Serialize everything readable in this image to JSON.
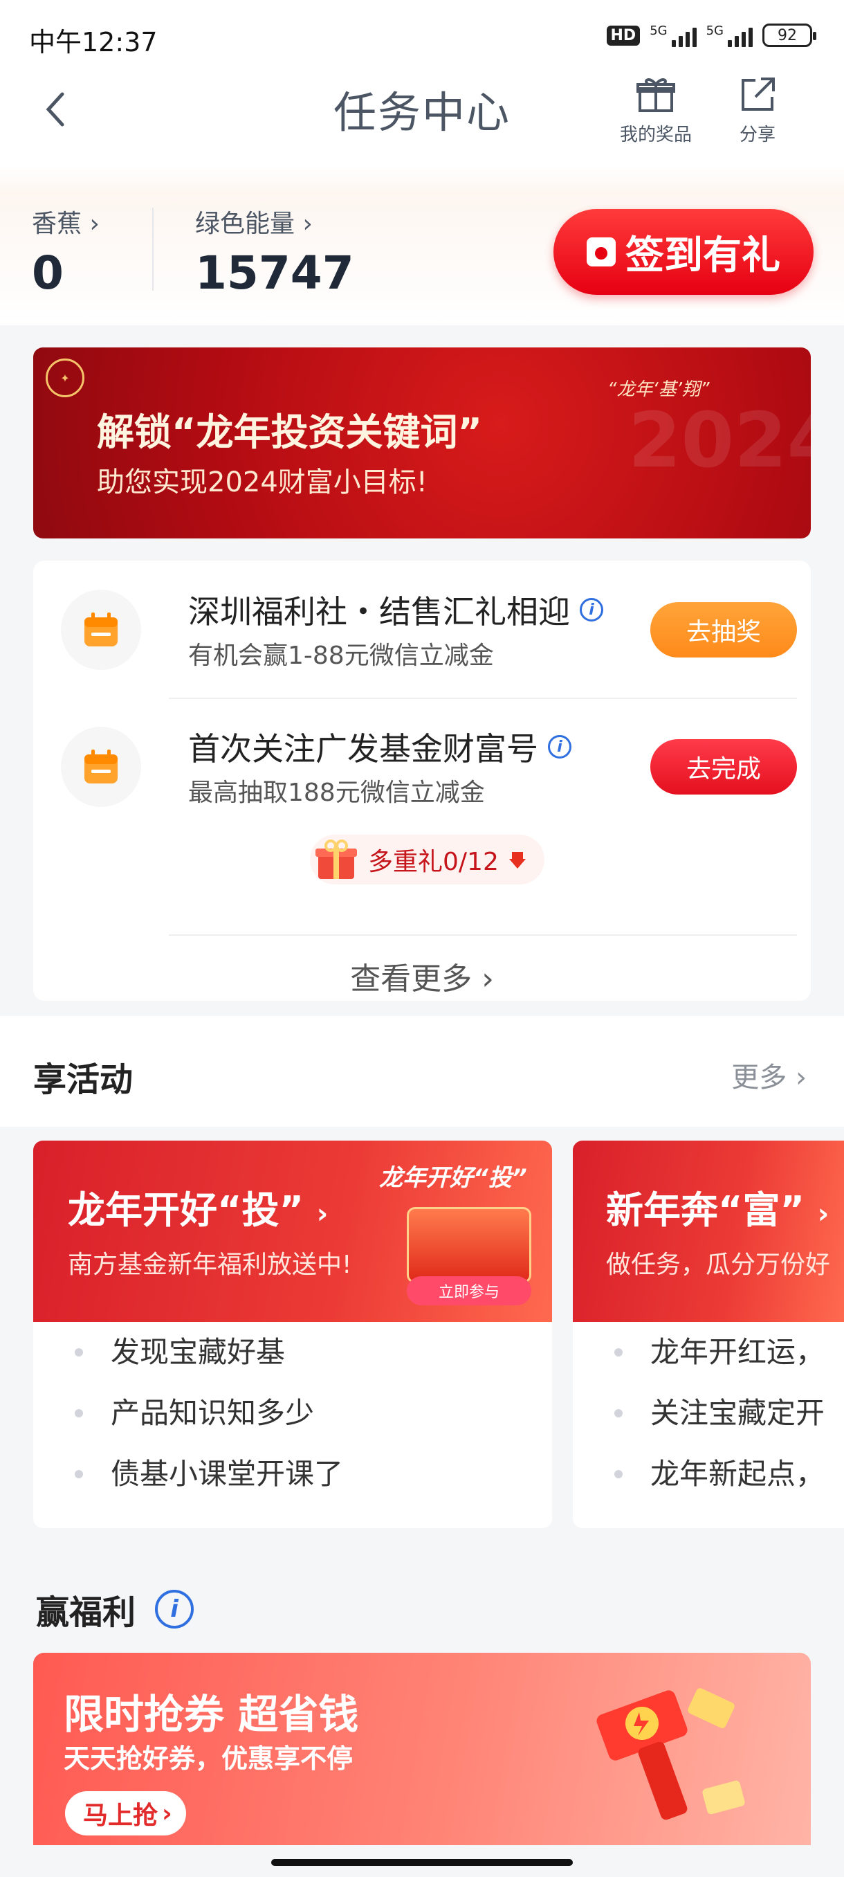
{
  "status_bar": {
    "time": "中午12:37",
    "hd": "HD",
    "net1": "5G",
    "net2": "5G",
    "battery": "92"
  },
  "header": {
    "title": "任务中心",
    "prizes_label": "我的奖品",
    "share_label": "分享"
  },
  "balance": {
    "banana_label": "香蕉",
    "banana_value": "0",
    "energy_label": "绿色能量",
    "energy_value": "15747",
    "checkin_label": "签到有礼"
  },
  "banner": {
    "title": "解锁“龙年投资关键词”",
    "subtitle": "助您实现2024财富小目标!",
    "tag": "“龙年‘基’翔”"
  },
  "tasks": [
    {
      "title": "深圳福利社・结售汇礼相迎",
      "subtitle": "有机会赢1-88元微信立减金",
      "button": "去抽奖"
    },
    {
      "title": "首次关注广发基金财富号",
      "subtitle": "最高抽取188元微信立减金",
      "button": "去完成"
    }
  ],
  "multi_gift": "多重礼0/12",
  "see_more": "查看更多",
  "activities": {
    "title": "享活动",
    "more": "更多",
    "cards": [
      {
        "title": "龙年开好“投”",
        "subtitle": "南方基金新年福利放送中!",
        "art_tag": "龙年开好“投”",
        "join": "立即参与",
        "items": [
          "发现宝藏好基",
          "产品知识知多少",
          "债基小课堂开课了"
        ]
      },
      {
        "title": "新年奔“富”",
        "subtitle": "做任务，瓜分万份好",
        "items": [
          "龙年开红运，",
          "关注宝藏定开",
          "龙年新起点，"
        ]
      }
    ]
  },
  "welfare": {
    "title": "赢福利",
    "promo_title": "限时抢券 超省钱",
    "promo_sub": "天天抢好券，优惠享不停",
    "promo_btn": "马上抢"
  },
  "colors": {
    "brand_red": "#e60012",
    "orange": "#ff8a1a",
    "text_gray": "#4b5563"
  }
}
